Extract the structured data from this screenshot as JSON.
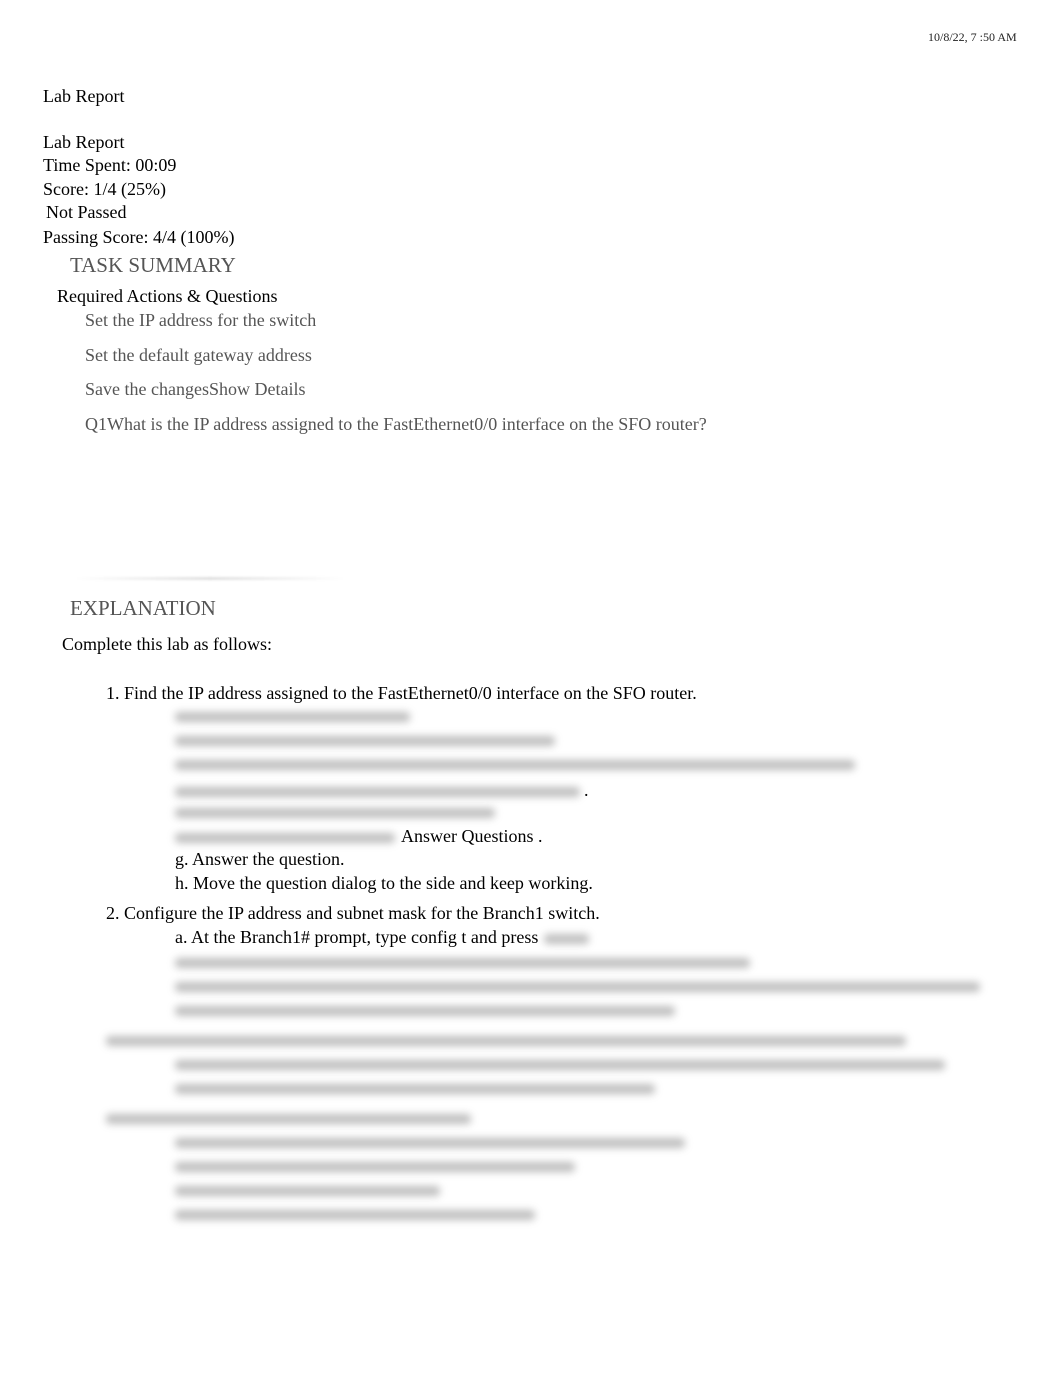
{
  "header": {
    "timestamp": "10/8/22, 7  :50 AM"
  },
  "page_title": "Lab Report",
  "summary": {
    "title": "Lab Report",
    "time_spent": "Time Spent: 00:09",
    "score": "Score: 1/4 (25%)",
    "status": "Not Passed",
    "passing_score": "Passing Score: 4/4 (100%)"
  },
  "task_summary": {
    "heading": "TASK SUMMARY",
    "subheading": "Required Actions & Questions",
    "items": [
      "Set the IP address for the switch",
      "Set the default gateway address",
      "Save the changesShow Details",
      "Q1What is the IP address assigned to the FastEthernet0/0 interface on the SFO router?"
    ]
  },
  "explanation": {
    "heading": "EXPLANATION",
    "intro": "Complete this lab as follows:",
    "step1": {
      "text": "1. Find the IP address assigned to the FastEthernet0/0 interface on the SFO router.",
      "f_suffix": "Answer Questions .",
      "g": "g. Answer the question.",
      "h": "h. Move the question dialog to the side and keep working."
    },
    "step2": {
      "text": "2. Configure the IP address and subnet mask for the Branch1 switch.",
      "a": "a. At the Branch1# prompt, type config t and press"
    }
  }
}
